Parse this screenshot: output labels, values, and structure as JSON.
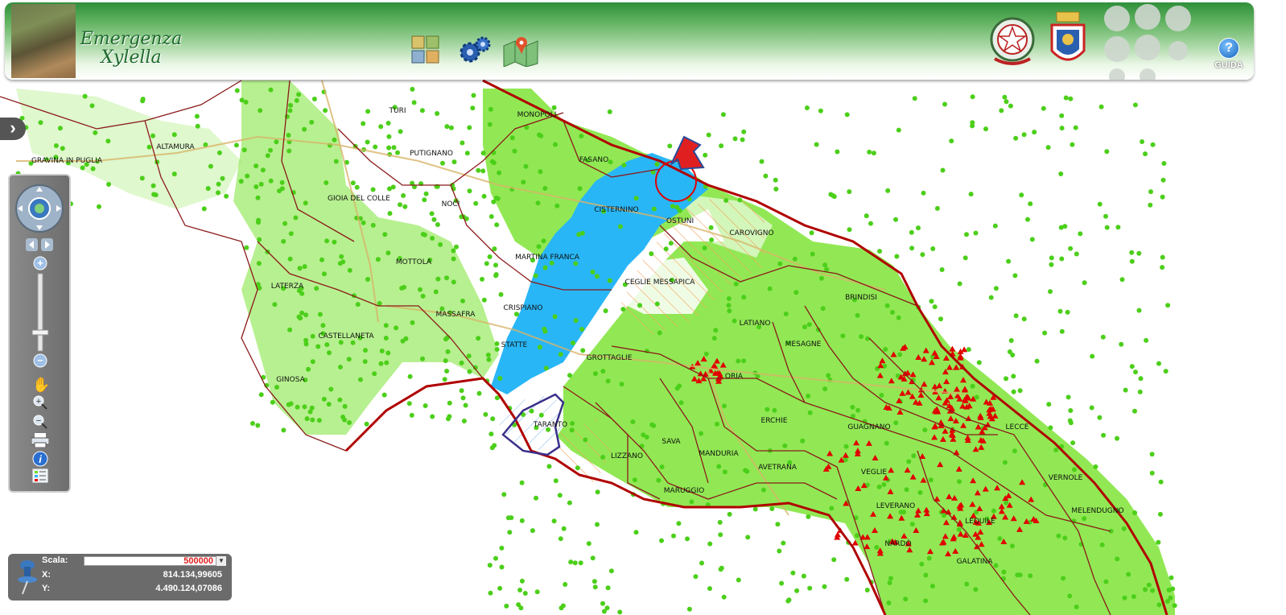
{
  "header": {
    "title_line1": "Emergenza",
    "title_line2": "Xylella",
    "guida_label": "GUIDA",
    "guida_symbol": "?",
    "tools": [
      "layers-icon",
      "settings-gears-icon",
      "map-pin-icon"
    ]
  },
  "map": {
    "towns": [
      {
        "name": "TURI"
      },
      {
        "name": "MONOPOLI"
      },
      {
        "name": "ALTAMURA"
      },
      {
        "name": "PUTIGNANO"
      },
      {
        "name": "FASANO"
      },
      {
        "name": "GRAVINA IN PUGLIA"
      },
      {
        "name": "GIOIA DEL COLLE"
      },
      {
        "name": "NOCI"
      },
      {
        "name": "CISTERNINO"
      },
      {
        "name": "OSTUNI"
      },
      {
        "name": "CAROVIGNO"
      },
      {
        "name": "MOTTOLA"
      },
      {
        "name": "MARTINA FRANCA"
      },
      {
        "name": "LATERZA"
      },
      {
        "name": "CEGLIE MESSAPICA"
      },
      {
        "name": "BRINDISI"
      },
      {
        "name": "CRISPIANO"
      },
      {
        "name": "MASSAFRA"
      },
      {
        "name": "CASTELLANETA"
      },
      {
        "name": "LATIANO"
      },
      {
        "name": "STATTE"
      },
      {
        "name": "MESAGNE"
      },
      {
        "name": "GROTTAGLIE"
      },
      {
        "name": "ORIA"
      },
      {
        "name": "GINOSA"
      },
      {
        "name": "ERCHIE"
      },
      {
        "name": "GUAGNANO"
      },
      {
        "name": "TARANTO"
      },
      {
        "name": "LECCE"
      },
      {
        "name": "SAVA"
      },
      {
        "name": "MANDURIA"
      },
      {
        "name": "LIZZANO"
      },
      {
        "name": "AVETRANA"
      },
      {
        "name": "VEGLIE"
      },
      {
        "name": "VERNOLE"
      },
      {
        "name": "MARUGGIO"
      },
      {
        "name": "LEVERANO"
      },
      {
        "name": "MELENDUGNO"
      },
      {
        "name": "LEQUILE"
      },
      {
        "name": "NARDÒ"
      },
      {
        "name": "GALATINA"
      }
    ],
    "colors": {
      "healthy": "#6ee01e",
      "infected_zone": "#29b6f6",
      "boundary": "#8b1a1a",
      "positive": "#e00000",
      "roads": "#d8b469"
    }
  },
  "scale": {
    "label": "Scala:",
    "value": "500000",
    "x_label": "X:",
    "x_value": "814.134,99605",
    "y_label": "Y:",
    "y_value": "4.490.124,07086"
  }
}
